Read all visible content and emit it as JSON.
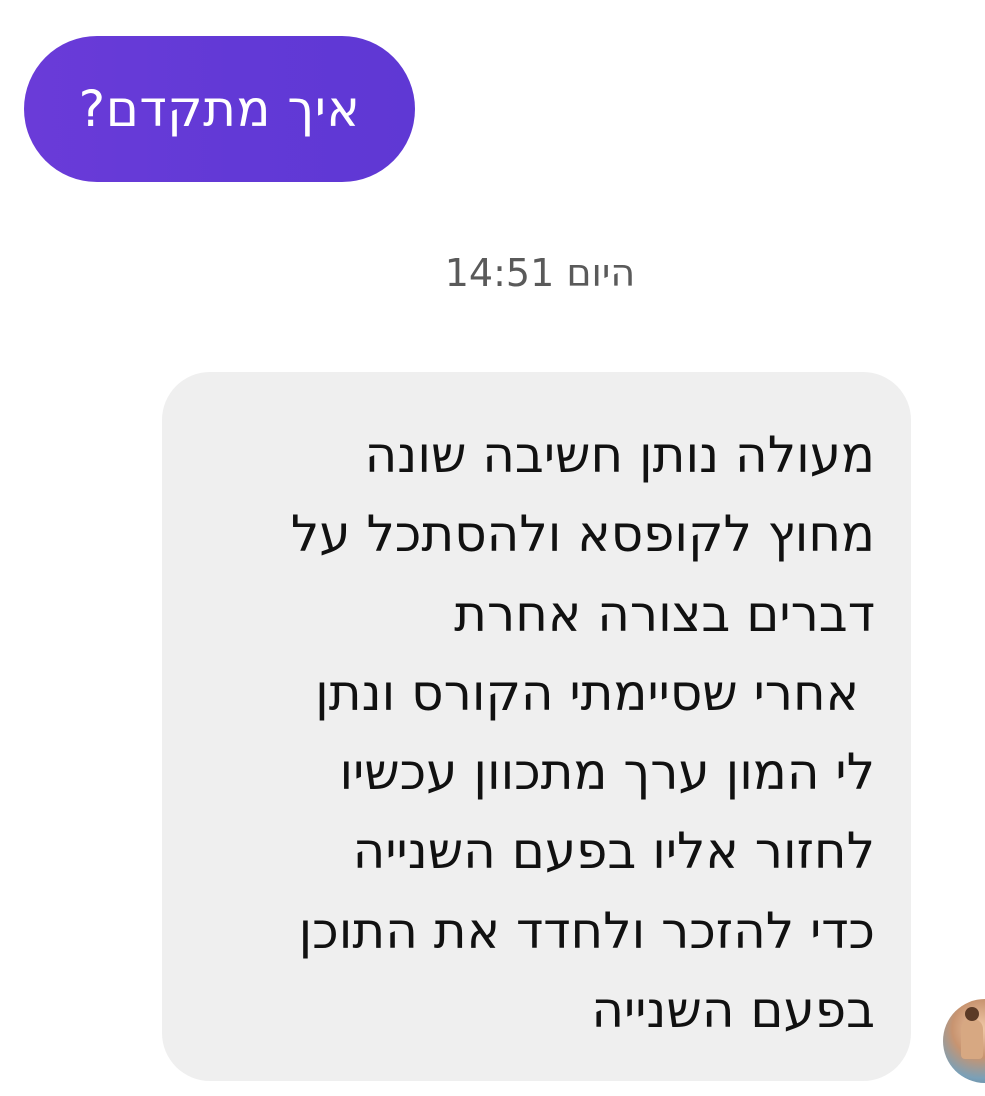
{
  "sent_message": {
    "text": "איך מתקדם?",
    "bubble_color": "#6239d6"
  },
  "timestamp": {
    "text": "היום 14:51"
  },
  "received_message": {
    "lines": [
      "מעולה נותן חשיבה שונה",
      "מחוץ לקופסא ולהסתכל על",
      "דברים בצורה אחרת",
      " אחרי שסיימתי הקורס ונתן",
      "לי המון ערך מתכוון עכשיו",
      "לחזור אליו בפעם השנייה",
      "כדי להזכר ולחדד את התוכן",
      "בפעם השנייה"
    ],
    "bubble_color": "#efefef"
  },
  "avatar": {
    "icon": "user-avatar"
  }
}
